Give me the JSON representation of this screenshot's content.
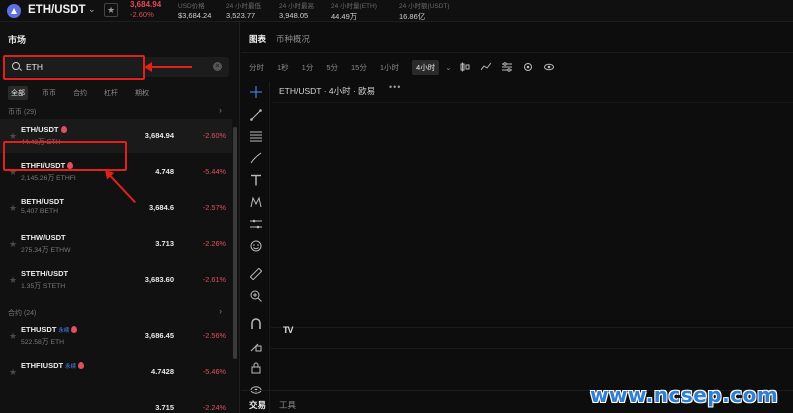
{
  "header": {
    "pair": "ETH/USDT",
    "price": "3,684.94",
    "change": "-2.60%",
    "stats": [
      {
        "label": "USD价格",
        "value": "$3,684.24"
      },
      {
        "label": "24 小时最低",
        "value": "3,523.77"
      },
      {
        "label": "24 小时最高",
        "value": "3,948.05"
      },
      {
        "label": "24 小时量(ETH)",
        "value": "44.49万"
      },
      {
        "label": "24 小时额(USDT)",
        "value": "16.86亿"
      }
    ]
  },
  "market": {
    "title": "市场",
    "search": {
      "value": "ETH"
    },
    "filters": [
      "全部",
      "币币",
      "合约",
      "杠杆",
      "期权"
    ],
    "section_spot": "币币 (29)",
    "section_contract": "合约 (24)",
    "spot_rows": [
      {
        "symbol": "ETH/USDT",
        "volume": "44.48万 ETH",
        "price": "3,684.94",
        "change": "-2.60%",
        "hot": true
      },
      {
        "symbol": "ETHFI/USDT",
        "volume": "2,145.26万 ETHFI",
        "price": "4.748",
        "change": "-5.44%",
        "hot": true
      },
      {
        "symbol": "BETH/USDT",
        "volume": "5,407 BETH",
        "price": "3,684.6",
        "change": "-2.57%",
        "hot": false
      },
      {
        "symbol": "ETHW/USDT",
        "volume": "275.34万 ETHW",
        "price": "3.713",
        "change": "-2.26%",
        "hot": false
      },
      {
        "symbol": "STETH/USDT",
        "volume": "1.35万 STETH",
        "price": "3,683.60",
        "change": "-2.61%",
        "hot": false
      }
    ],
    "contract_rows": [
      {
        "symbol": "ETHUSDT",
        "badge": "永续",
        "volume": "522.58万 ETH",
        "price": "3,686.45",
        "change": "-2.56%",
        "hot": true
      },
      {
        "symbol": "ETHFIUSDT",
        "badge": "永续",
        "volume": "",
        "price": "4.7428",
        "change": "-5.46%",
        "hot": true
      },
      {
        "symbol": "",
        "badge": "",
        "volume": "",
        "price": "3.715",
        "change": "-2.24%",
        "hot": false
      }
    ]
  },
  "chart": {
    "tabs": [
      "图表",
      "币种概况"
    ],
    "intervals": [
      "分时",
      "1秒",
      "1分",
      "5分",
      "15分",
      "1小时",
      "4小时"
    ],
    "active_interval": "4小时",
    "caption": "ETH/USDT · 4小时 · 欧易",
    "menu": "•••",
    "tv_logo": "TV",
    "bottom_tabs": [
      "交易",
      "工具"
    ]
  },
  "icons": {
    "toolbar": [
      "candle-type-icon",
      "indicator-icon",
      "settings-icon",
      "layout-icon",
      "gear-icon",
      "eye-icon"
    ],
    "drawing": [
      "crosshair-icon",
      "trend-line-icon",
      "fib-icon",
      "brush-icon",
      "text-icon",
      "pattern-icon",
      "measure-icon",
      "emoji-icon",
      "ruler-icon",
      "zoom-icon",
      "magnet-icon",
      "lock-draw-icon",
      "lock-icon",
      "eye-icon"
    ]
  },
  "colors": {
    "negative": "#e0505e",
    "annotation": "#e0211d",
    "accent": "#5f6fe0"
  },
  "watermark": "www.ncsep.com"
}
